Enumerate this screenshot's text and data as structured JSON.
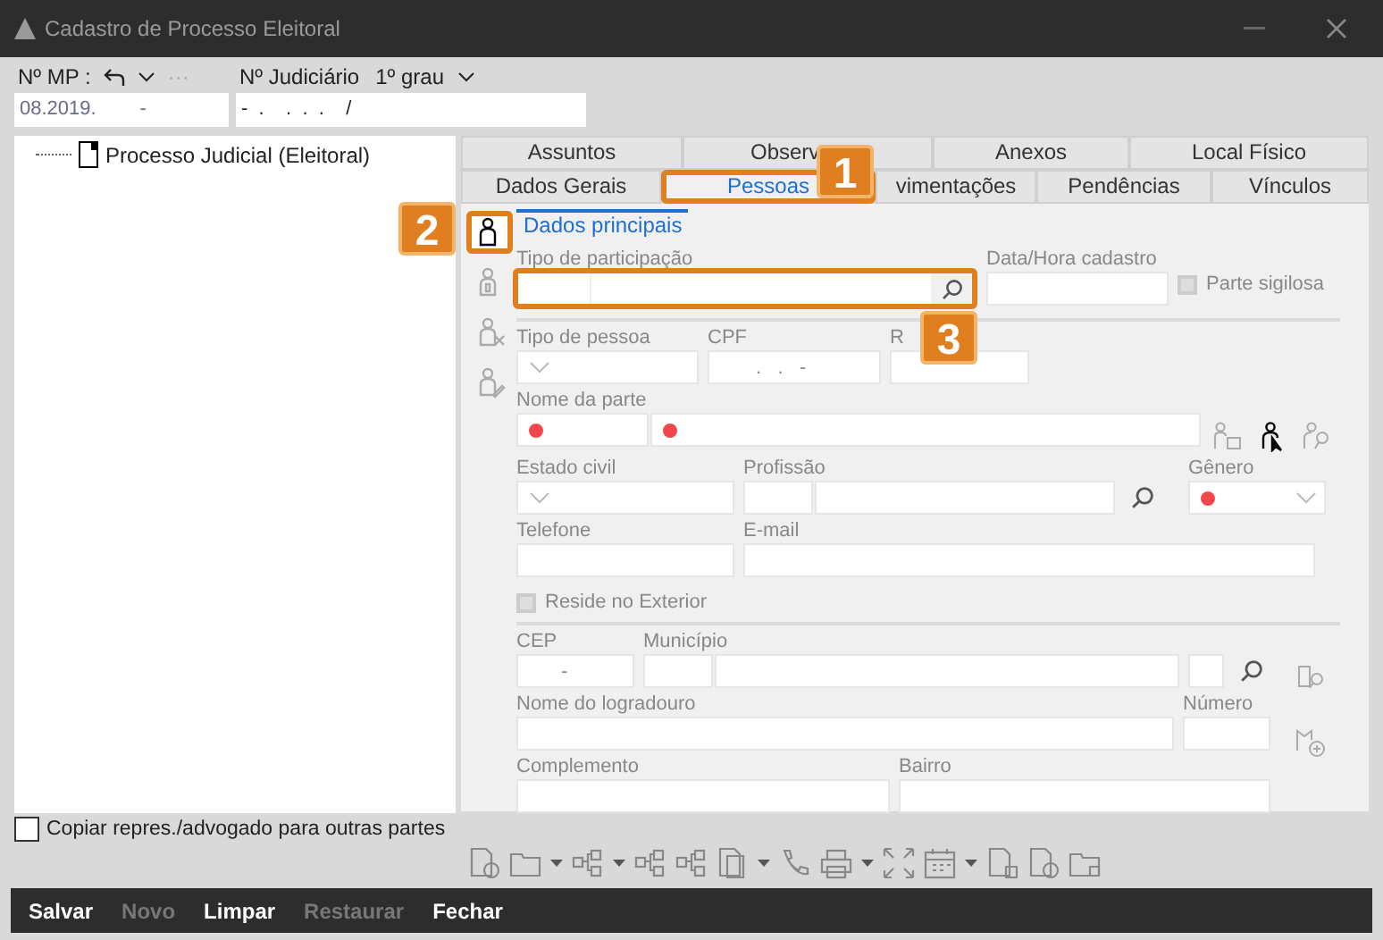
{
  "window": {
    "title": "Cadastro de Processo Eleitoral"
  },
  "header": {
    "mp_label": "Nº MP :",
    "more": "···",
    "judiciario_label": "Nº Judiciário",
    "grau": "1º grau",
    "mp_value": "08.2019.        -",
    "judiciario_value": "-  .    .  .  .    /"
  },
  "tree": [
    {
      "label": "Processo Judicial (Eleitoral)"
    }
  ],
  "copy_option": {
    "label": "Copiar repres./advogado para outras partes",
    "checked": false
  },
  "tabs_top": [
    {
      "label": "Assuntos",
      "selected": false
    },
    {
      "label": "Observ",
      "selected": false
    },
    {
      "label": "Anexos",
      "selected": false
    },
    {
      "label": "Local Físico",
      "selected": false
    }
  ],
  "tabs_bottom": [
    {
      "label": "Dados Gerais",
      "selected": false,
      "highlighted": false
    },
    {
      "label": "Pessoas",
      "selected": true,
      "highlighted": true
    },
    {
      "label": "vimentações",
      "selected": false,
      "highlighted": false
    },
    {
      "label": "Pendências",
      "selected": false,
      "highlighted": false
    },
    {
      "label": "Vínculos",
      "selected": false,
      "highlighted": false
    }
  ],
  "side_icons": [
    {
      "kind": "person",
      "selected": true,
      "highlighted": true
    },
    {
      "kind": "person-badge",
      "selected": false,
      "highlighted": false
    },
    {
      "kind": "person-remove",
      "selected": false,
      "highlighted": false
    },
    {
      "kind": "person-edit",
      "selected": false,
      "highlighted": false
    }
  ],
  "subtab": {
    "label": "Dados principais",
    "selected": true
  },
  "form": {
    "tipo_participacao": {
      "label": "Tipo de participação",
      "highlighted": true
    },
    "data_hora": {
      "label": "Data/Hora cadastro"
    },
    "parte_sigilosa": {
      "label": "Parte sigilosa",
      "checked": false
    },
    "tipo_pessoa": {
      "label": "Tipo de pessoa"
    },
    "cpf": {
      "label": "CPF",
      "value": ".   .   -"
    },
    "rg": {
      "label": "R"
    },
    "nome_parte": {
      "label": "Nome da parte",
      "required": true
    },
    "estado_civil": {
      "label": "Estado civil"
    },
    "profissao": {
      "label": "Profissão"
    },
    "genero": {
      "label": "Gênero",
      "required": true
    },
    "telefone": {
      "label": "Telefone"
    },
    "email": {
      "label": "E-mail"
    },
    "reside_exterior": {
      "label": "Reside no Exterior",
      "checked": false
    },
    "cep": {
      "label": "CEP",
      "value": "-"
    },
    "municipio": {
      "label": "Município"
    },
    "logradouro": {
      "label": "Nome do logradouro"
    },
    "numero": {
      "label": "Número"
    },
    "complemento": {
      "label": "Complemento"
    },
    "bairro": {
      "label": "Bairro"
    }
  },
  "callouts": [
    {
      "number": "1"
    },
    {
      "number": "2"
    },
    {
      "number": "3"
    }
  ],
  "footer_buttons": [
    {
      "label": "Salvar",
      "disabled": false
    },
    {
      "label": "Novo",
      "disabled": true
    },
    {
      "label": "Limpar",
      "disabled": false
    },
    {
      "label": "Restaurar",
      "disabled": true
    },
    {
      "label": "Fechar",
      "disabled": false
    }
  ]
}
